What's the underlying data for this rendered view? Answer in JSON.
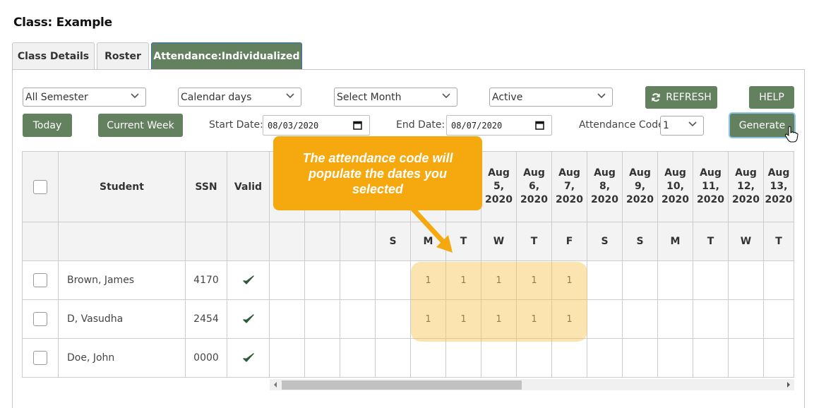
{
  "page_title": "Class: Example",
  "tabs": [
    {
      "label": "Class Details",
      "active": false
    },
    {
      "label": "Roster",
      "active": false
    },
    {
      "label": "Attendance:Individualized",
      "active": true
    }
  ],
  "filters": {
    "semester": "All Semester",
    "day_type": "Calendar days",
    "month": "Select Month",
    "status": "Active",
    "refresh_label": "REFRESH",
    "refresh_icon": "refresh-icon",
    "help_label": "HELP"
  },
  "controls": {
    "today_label": "Today",
    "current_week_label": "Current Week",
    "start_date_label": "Start Date:",
    "start_date_value": "08/03/2020",
    "end_date_label": "End Date:",
    "end_date_value": "08/07/2020",
    "attendance_code_label": "Attendance Code:",
    "attendance_code_value": "1",
    "generate_label": "Generate"
  },
  "table": {
    "headers": {
      "student": "Student",
      "ssn": "SSN",
      "valid": "Valid"
    },
    "date_columns": [
      {
        "date": "",
        "day": ""
      },
      {
        "date": "",
        "day": ""
      },
      {
        "date": "",
        "day": ""
      },
      {
        "date": "",
        "day": "S"
      },
      {
        "date": "",
        "day": "M"
      },
      {
        "date": "",
        "day": "T"
      },
      {
        "date": "Aug 5, 2020",
        "day": "W"
      },
      {
        "date": "Aug 6, 2020",
        "day": "T"
      },
      {
        "date": "Aug 7, 2020",
        "day": "F"
      },
      {
        "date": "Aug 8, 2020",
        "day": "S"
      },
      {
        "date": "Aug 9, 2020",
        "day": "S"
      },
      {
        "date": "Aug 10, 2020",
        "day": "M"
      },
      {
        "date": "Aug 11, 2020",
        "day": "T"
      },
      {
        "date": "Aug 12, 2020",
        "day": "W"
      },
      {
        "date": "Aug 13, 2020",
        "day": "T"
      }
    ],
    "rows": [
      {
        "student": "Brown, James",
        "ssn": "4170",
        "valid": true,
        "codes": [
          "",
          "",
          "",
          "",
          "1",
          "1",
          "1",
          "1",
          "1",
          "",
          "",
          "",
          "",
          "",
          ""
        ]
      },
      {
        "student": "D, Vasudha",
        "ssn": "2454",
        "valid": true,
        "codes": [
          "",
          "",
          "",
          "",
          "1",
          "1",
          "1",
          "1",
          "1",
          "",
          "",
          "",
          "",
          "",
          ""
        ]
      },
      {
        "student": "Doe, John",
        "ssn": "0000",
        "valid": true,
        "codes": [
          "",
          "",
          "",
          "",
          "",
          "",
          "",
          "",
          "",
          "",
          "",
          "",
          "",
          "",
          ""
        ]
      }
    ]
  },
  "callout": {
    "text": "The attendance code will populate the dates you selected"
  },
  "colors": {
    "button_green": "#63805f",
    "callout_orange": "#f5a90f",
    "check_green": "#2e5a3a"
  }
}
